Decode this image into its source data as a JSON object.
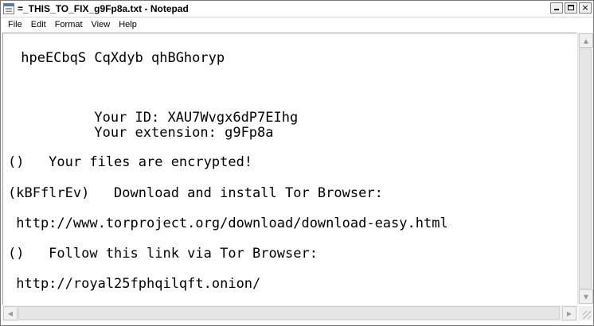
{
  "window": {
    "title": "=_THIS_TO_FIX_g9Fp8a.txt - Notepad",
    "controls": {
      "minimize": "",
      "maximize": "",
      "close": "×"
    }
  },
  "menu": {
    "items": [
      "File",
      "Edit",
      "Format",
      "View",
      "Help"
    ]
  },
  "document": {
    "lines": [
      " hpeECbqS CqXdyb qhBGhoryp",
      "          Your ID: XAU7Wvgx6dP7EIhg",
      "          Your extension: g9Fp8a",
      "()   Your files are encrypted!",
      "(kBFflrEv)   Download and install Tor Browser:",
      " http://www.torproject.org/download/download-easy.html",
      "()   Follow this link via Tor Browser:",
      " http://royal25fphqilqft.onion/"
    ]
  },
  "scrollbars": {
    "up_arrow": "▲",
    "down_arrow": "▼",
    "left_arrow": "◀",
    "right_arrow": "▶"
  },
  "icons": {
    "app": "notepad-icon",
    "minimize": "minimize-icon",
    "maximize": "maximize-icon",
    "close": "close-icon"
  }
}
